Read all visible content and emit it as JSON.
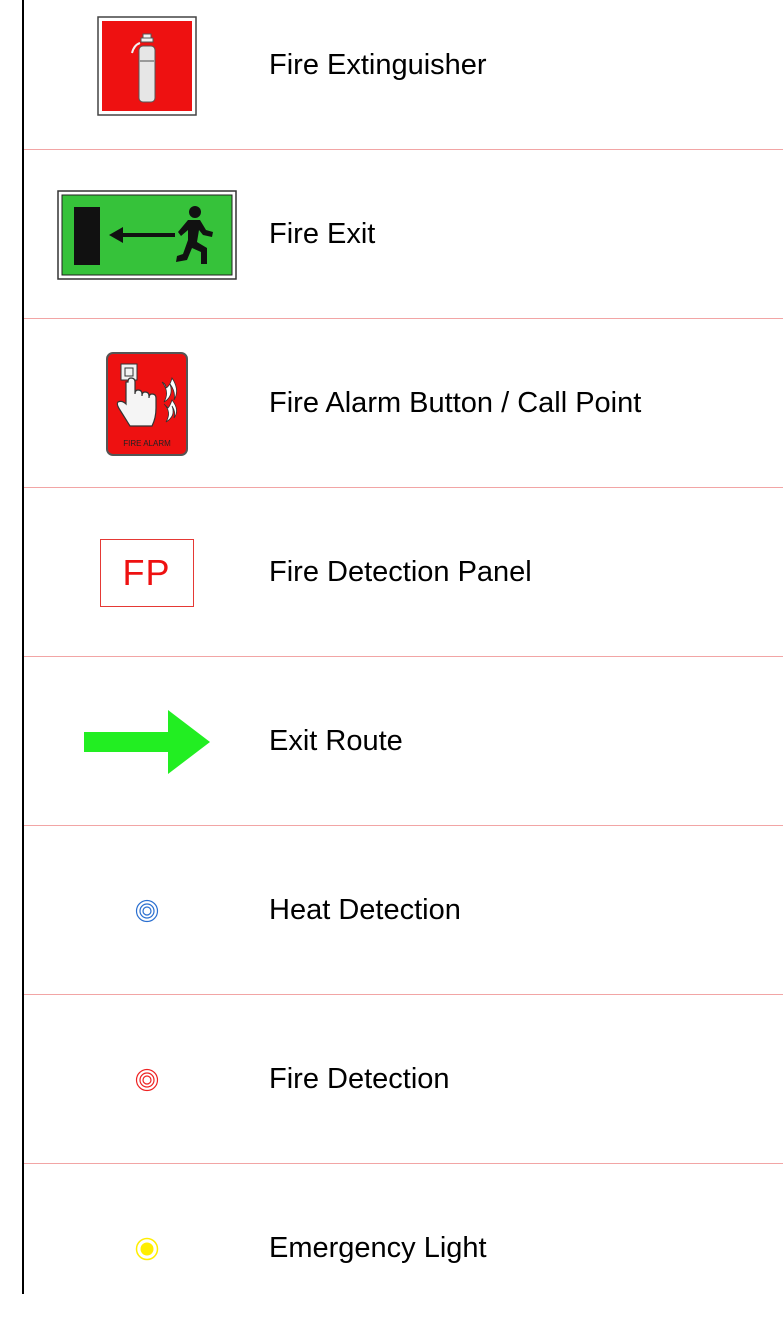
{
  "legend": {
    "items": [
      {
        "label": "Fire Extinguisher",
        "icon": "fire-extinguisher-icon"
      },
      {
        "label": "Fire Exit",
        "icon": "fire-exit-sign-icon"
      },
      {
        "label": "Fire Alarm Button / Call Point",
        "icon": "fire-alarm-call-point-icon",
        "icon_text": "FIRE ALARM"
      },
      {
        "label": "Fire Detection Panel",
        "icon": "fire-detection-panel-icon",
        "icon_text": "FP"
      },
      {
        "label": "Exit Route",
        "icon": "exit-route-arrow-icon"
      },
      {
        "label": "Heat Detection",
        "icon": "heat-detector-icon"
      },
      {
        "label": "Fire Detection",
        "icon": "fire-detector-icon"
      },
      {
        "label": "Emergency Light",
        "icon": "emergency-light-icon"
      }
    ]
  },
  "colors": {
    "extinguisher_red": "#ee1111",
    "exit_green": "#36c23a",
    "arrow_green": "#22ee22",
    "heat_blue": "#2a6fd0",
    "fire_red": "#ee2222",
    "light_yellow": "#ffee00",
    "divider": "#f2a5a5"
  }
}
